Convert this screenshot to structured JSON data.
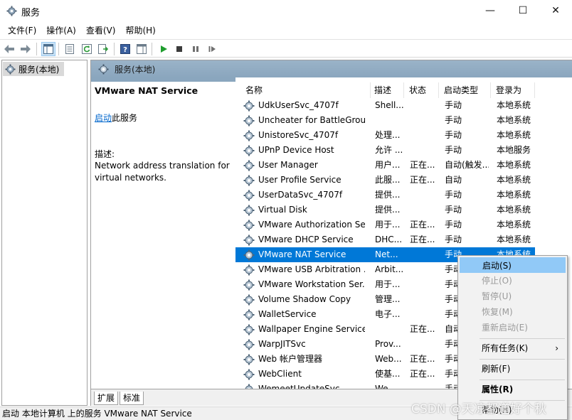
{
  "window": {
    "title": "服务",
    "minimize_glyph": "—",
    "maximize_glyph": "☐",
    "close_glyph": "✕"
  },
  "menu": [
    "文件(F)",
    "操作(A)",
    "查看(V)",
    "帮助(H)"
  ],
  "toolbar_icons": [
    "back-arrow-icon",
    "forward-arrow-icon",
    "console-tree-icon",
    "properties-icon",
    "refresh-icon",
    "export-list-icon",
    "help-icon",
    "show-pane-icon",
    "play-icon",
    "stop-icon",
    "pause-icon",
    "restart-icon"
  ],
  "tree": {
    "root_label": "服务(本地)"
  },
  "panel": {
    "header_label": "服务(本地)"
  },
  "description": {
    "service_name": "VMware NAT Service",
    "link_text": "启动",
    "link_suffix": "此服务",
    "label": "描述:",
    "text": "Network address translation for virtual networks."
  },
  "columns": {
    "name": "名称",
    "desc": "描述",
    "status": "状态",
    "startup": "启动类型",
    "logon": "登录为"
  },
  "rows": [
    {
      "name": "UdkUserSvc_4707f",
      "desc": "Shell...",
      "status": "",
      "startup": "手动",
      "logon": "本地系统"
    },
    {
      "name": "Uncheater for BattleGrou...",
      "desc": "",
      "status": "",
      "startup": "手动",
      "logon": "本地系统"
    },
    {
      "name": "UnistoreSvc_4707f",
      "desc": "处理...",
      "status": "",
      "startup": "手动",
      "logon": "本地系统"
    },
    {
      "name": "UPnP Device Host",
      "desc": "允许 ...",
      "status": "",
      "startup": "手动",
      "logon": "本地服务"
    },
    {
      "name": "User Manager",
      "desc": "用户...",
      "status": "正在...",
      "startup": "自动(触发...",
      "logon": "本地系统"
    },
    {
      "name": "User Profile Service",
      "desc": "此服...",
      "status": "正在...",
      "startup": "自动",
      "logon": "本地系统"
    },
    {
      "name": "UserDataSvc_4707f",
      "desc": "提供...",
      "status": "",
      "startup": "手动",
      "logon": "本地系统"
    },
    {
      "name": "Virtual Disk",
      "desc": "提供...",
      "status": "",
      "startup": "手动",
      "logon": "本地系统"
    },
    {
      "name": "VMware Authorization Se...",
      "desc": "用于...",
      "status": "正在...",
      "startup": "手动",
      "logon": "本地系统"
    },
    {
      "name": "VMware DHCP Service",
      "desc": "DHC...",
      "status": "正在...",
      "startup": "手动",
      "logon": "本地系统"
    },
    {
      "name": "VMware NAT Service",
      "desc": "Net...",
      "status": "",
      "startup": "手动",
      "logon": "本地系统",
      "selected": true
    },
    {
      "name": "VMware USB Arbitration ...",
      "desc": "Arbit...",
      "status": "",
      "startup": "手动",
      "logon": ""
    },
    {
      "name": "VMware Workstation Ser...",
      "desc": "用于...",
      "status": "",
      "startup": "手动",
      "logon": ""
    },
    {
      "name": "Volume Shadow Copy",
      "desc": "管理...",
      "status": "",
      "startup": "手动",
      "logon": ""
    },
    {
      "name": "WalletService",
      "desc": "电子...",
      "status": "",
      "startup": "手动",
      "logon": ""
    },
    {
      "name": "Wallpaper Engine Service",
      "desc": "",
      "status": "正在...",
      "startup": "自动",
      "logon": ""
    },
    {
      "name": "WarpJITSvc",
      "desc": "Prov...",
      "status": "",
      "startup": "手动",
      "logon": ""
    },
    {
      "name": "Web 帐户管理器",
      "desc": "Web...",
      "status": "正在...",
      "startup": "手动",
      "logon": ""
    },
    {
      "name": "WebClient",
      "desc": "使基...",
      "status": "正在...",
      "startup": "手动",
      "logon": ""
    },
    {
      "name": "WemeetUpdateSvc",
      "desc": "We...",
      "status": "",
      "startup": "手动",
      "logon": ""
    }
  ],
  "tabs": [
    "扩展",
    "标准"
  ],
  "status_bar": "启动 本地计算机 上的服务 VMware NAT Service",
  "context_menu": {
    "start": "启动(S)",
    "stop": "停止(O)",
    "pause": "暂停(U)",
    "resume": "恢复(M)",
    "restart": "重新启动(E)",
    "all_tasks": "所有任务(K)",
    "refresh": "刷新(F)",
    "properties": "属性(R)",
    "help": "帮助(H)"
  },
  "watermark": "CSDN @天凉都道好个秋",
  "colors": {
    "selection": "#0078d7",
    "header_band": "#8aa6be",
    "menu_highlight": "#91c9f7",
    "link": "#0066cc"
  }
}
